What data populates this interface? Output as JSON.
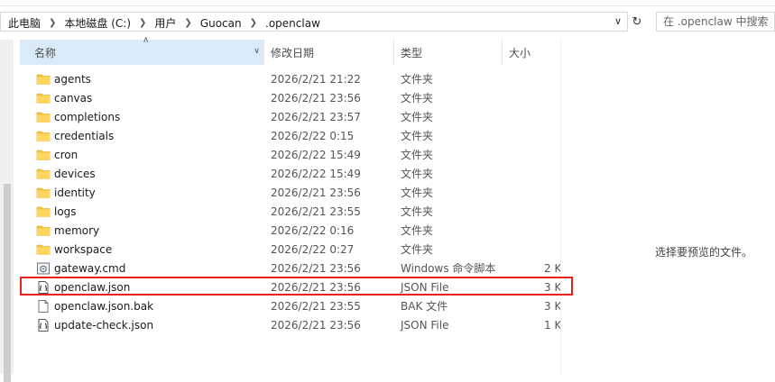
{
  "address": {
    "crumbs": [
      "此电脑",
      "本地磁盘 (C:)",
      "用户",
      "Guocan",
      ".openclaw"
    ]
  },
  "search": {
    "placeholder": "在 .openclaw 中搜索"
  },
  "columns": {
    "name": "名称",
    "date": "修改日期",
    "type": "类型",
    "size": "大小"
  },
  "files": [
    {
      "name": "agents",
      "date": "2026/2/21 21:22",
      "type": "文件夹",
      "size": "",
      "kind": "folder"
    },
    {
      "name": "canvas",
      "date": "2026/2/21 23:56",
      "type": "文件夹",
      "size": "",
      "kind": "folder"
    },
    {
      "name": "completions",
      "date": "2026/2/21 23:57",
      "type": "文件夹",
      "size": "",
      "kind": "folder"
    },
    {
      "name": "credentials",
      "date": "2026/2/22 0:15",
      "type": "文件夹",
      "size": "",
      "kind": "folder"
    },
    {
      "name": "cron",
      "date": "2026/2/22 15:49",
      "type": "文件夹",
      "size": "",
      "kind": "folder"
    },
    {
      "name": "devices",
      "date": "2026/2/22 15:49",
      "type": "文件夹",
      "size": "",
      "kind": "folder"
    },
    {
      "name": "identity",
      "date": "2026/2/21 23:56",
      "type": "文件夹",
      "size": "",
      "kind": "folder"
    },
    {
      "name": "logs",
      "date": "2026/2/21 23:55",
      "type": "文件夹",
      "size": "",
      "kind": "folder"
    },
    {
      "name": "memory",
      "date": "2026/2/22 0:16",
      "type": "文件夹",
      "size": "",
      "kind": "folder"
    },
    {
      "name": "workspace",
      "date": "2026/2/22 0:27",
      "type": "文件夹",
      "size": "",
      "kind": "folder"
    },
    {
      "name": "gateway.cmd",
      "date": "2026/2/21 23:56",
      "type": "Windows 命令脚本",
      "size": "2 K",
      "kind": "cmd"
    },
    {
      "name": "openclaw.json",
      "date": "2026/2/21 23:56",
      "type": "JSON File",
      "size": "3 K",
      "kind": "json"
    },
    {
      "name": "openclaw.json.bak",
      "date": "2026/2/21 23:55",
      "type": "BAK 文件",
      "size": "3 K",
      "kind": "doc"
    },
    {
      "name": "update-check.json",
      "date": "2026/2/21 23:56",
      "type": "JSON File",
      "size": "1 K",
      "kind": "json"
    }
  ],
  "preview": {
    "empty_text": "选择要预览的文件。"
  },
  "colors": {
    "folder": "#f5c542",
    "highlight": "#e8231e",
    "header_selected": "#d9ebf9"
  }
}
